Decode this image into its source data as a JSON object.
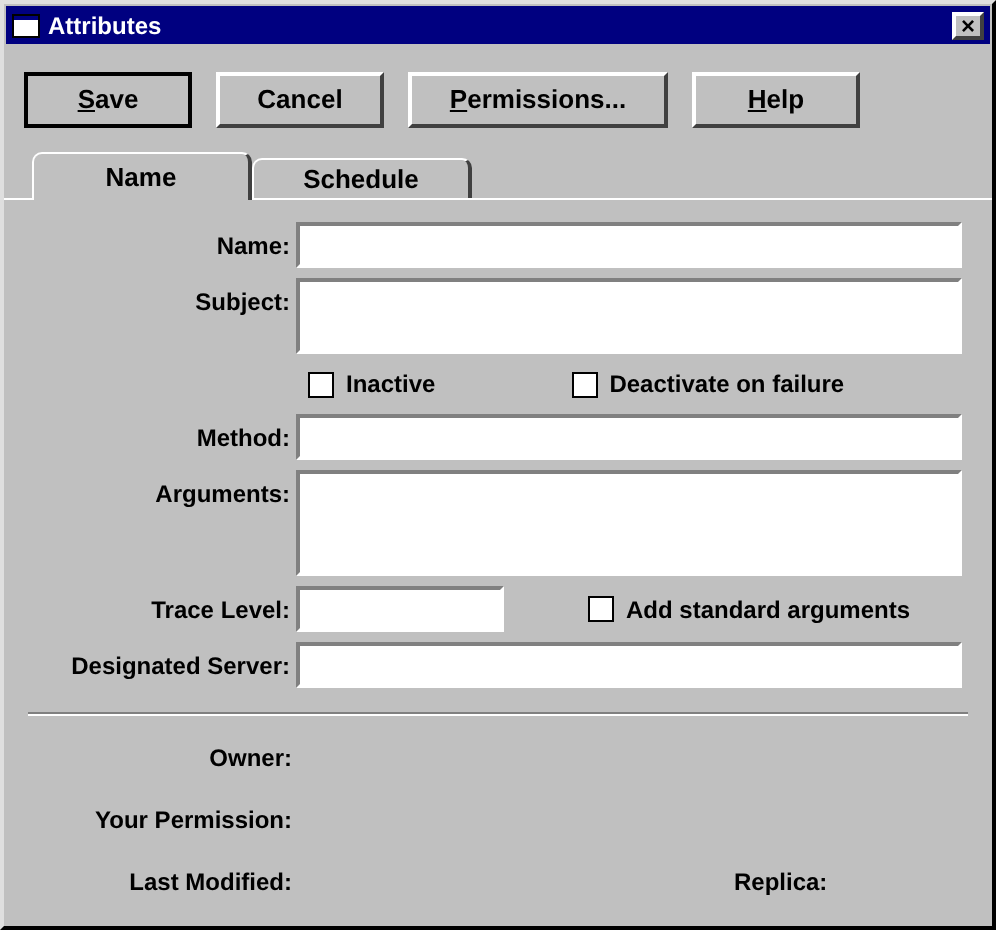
{
  "window": {
    "title": "Attributes",
    "close": "×"
  },
  "buttons": [
    {
      "label_parts": [
        {
          "text": "S",
          "underline": true
        },
        {
          "text": "ave",
          "underline": false
        }
      ],
      "default": true
    },
    {
      "label_parts": [
        {
          "text": "Cancel",
          "underline": false
        }
      ],
      "default": false
    },
    {
      "label_parts": [
        {
          "text": "P",
          "underline": true
        },
        {
          "text": "ermissions...",
          "underline": false
        }
      ],
      "default": false
    },
    {
      "label_parts": [
        {
          "text": "H",
          "underline": true
        },
        {
          "text": "elp",
          "underline": false
        }
      ],
      "default": false
    }
  ],
  "tabs": [
    {
      "label": "Name",
      "selected": true
    },
    {
      "label": "Schedule",
      "selected": false
    }
  ],
  "form": [
    {
      "kind": "field",
      "label": "Name:"
    },
    {
      "kind": "short_memo",
      "label": "Subject:"
    },
    {
      "kind": "checks",
      "checks": [
        {
          "label": "Inactive",
          "checked": false
        },
        {
          "label": "Deactivate on failure",
          "checked": false
        }
      ]
    },
    {
      "kind": "field",
      "label": "Method:"
    },
    {
      "kind": "memo",
      "label": "Arguments:"
    },
    {
      "kind": "field_check",
      "label": "Trace Level:",
      "check": {
        "label": "Add standard arguments",
        "checked": false
      }
    },
    {
      "kind": "field",
      "label": "Designated Server:"
    }
  ],
  "info": [
    {
      "label": "Owner:"
    },
    {
      "label": "Your Permission:"
    },
    {
      "label": "Last Modified:",
      "extra": "Replica:"
    }
  ]
}
